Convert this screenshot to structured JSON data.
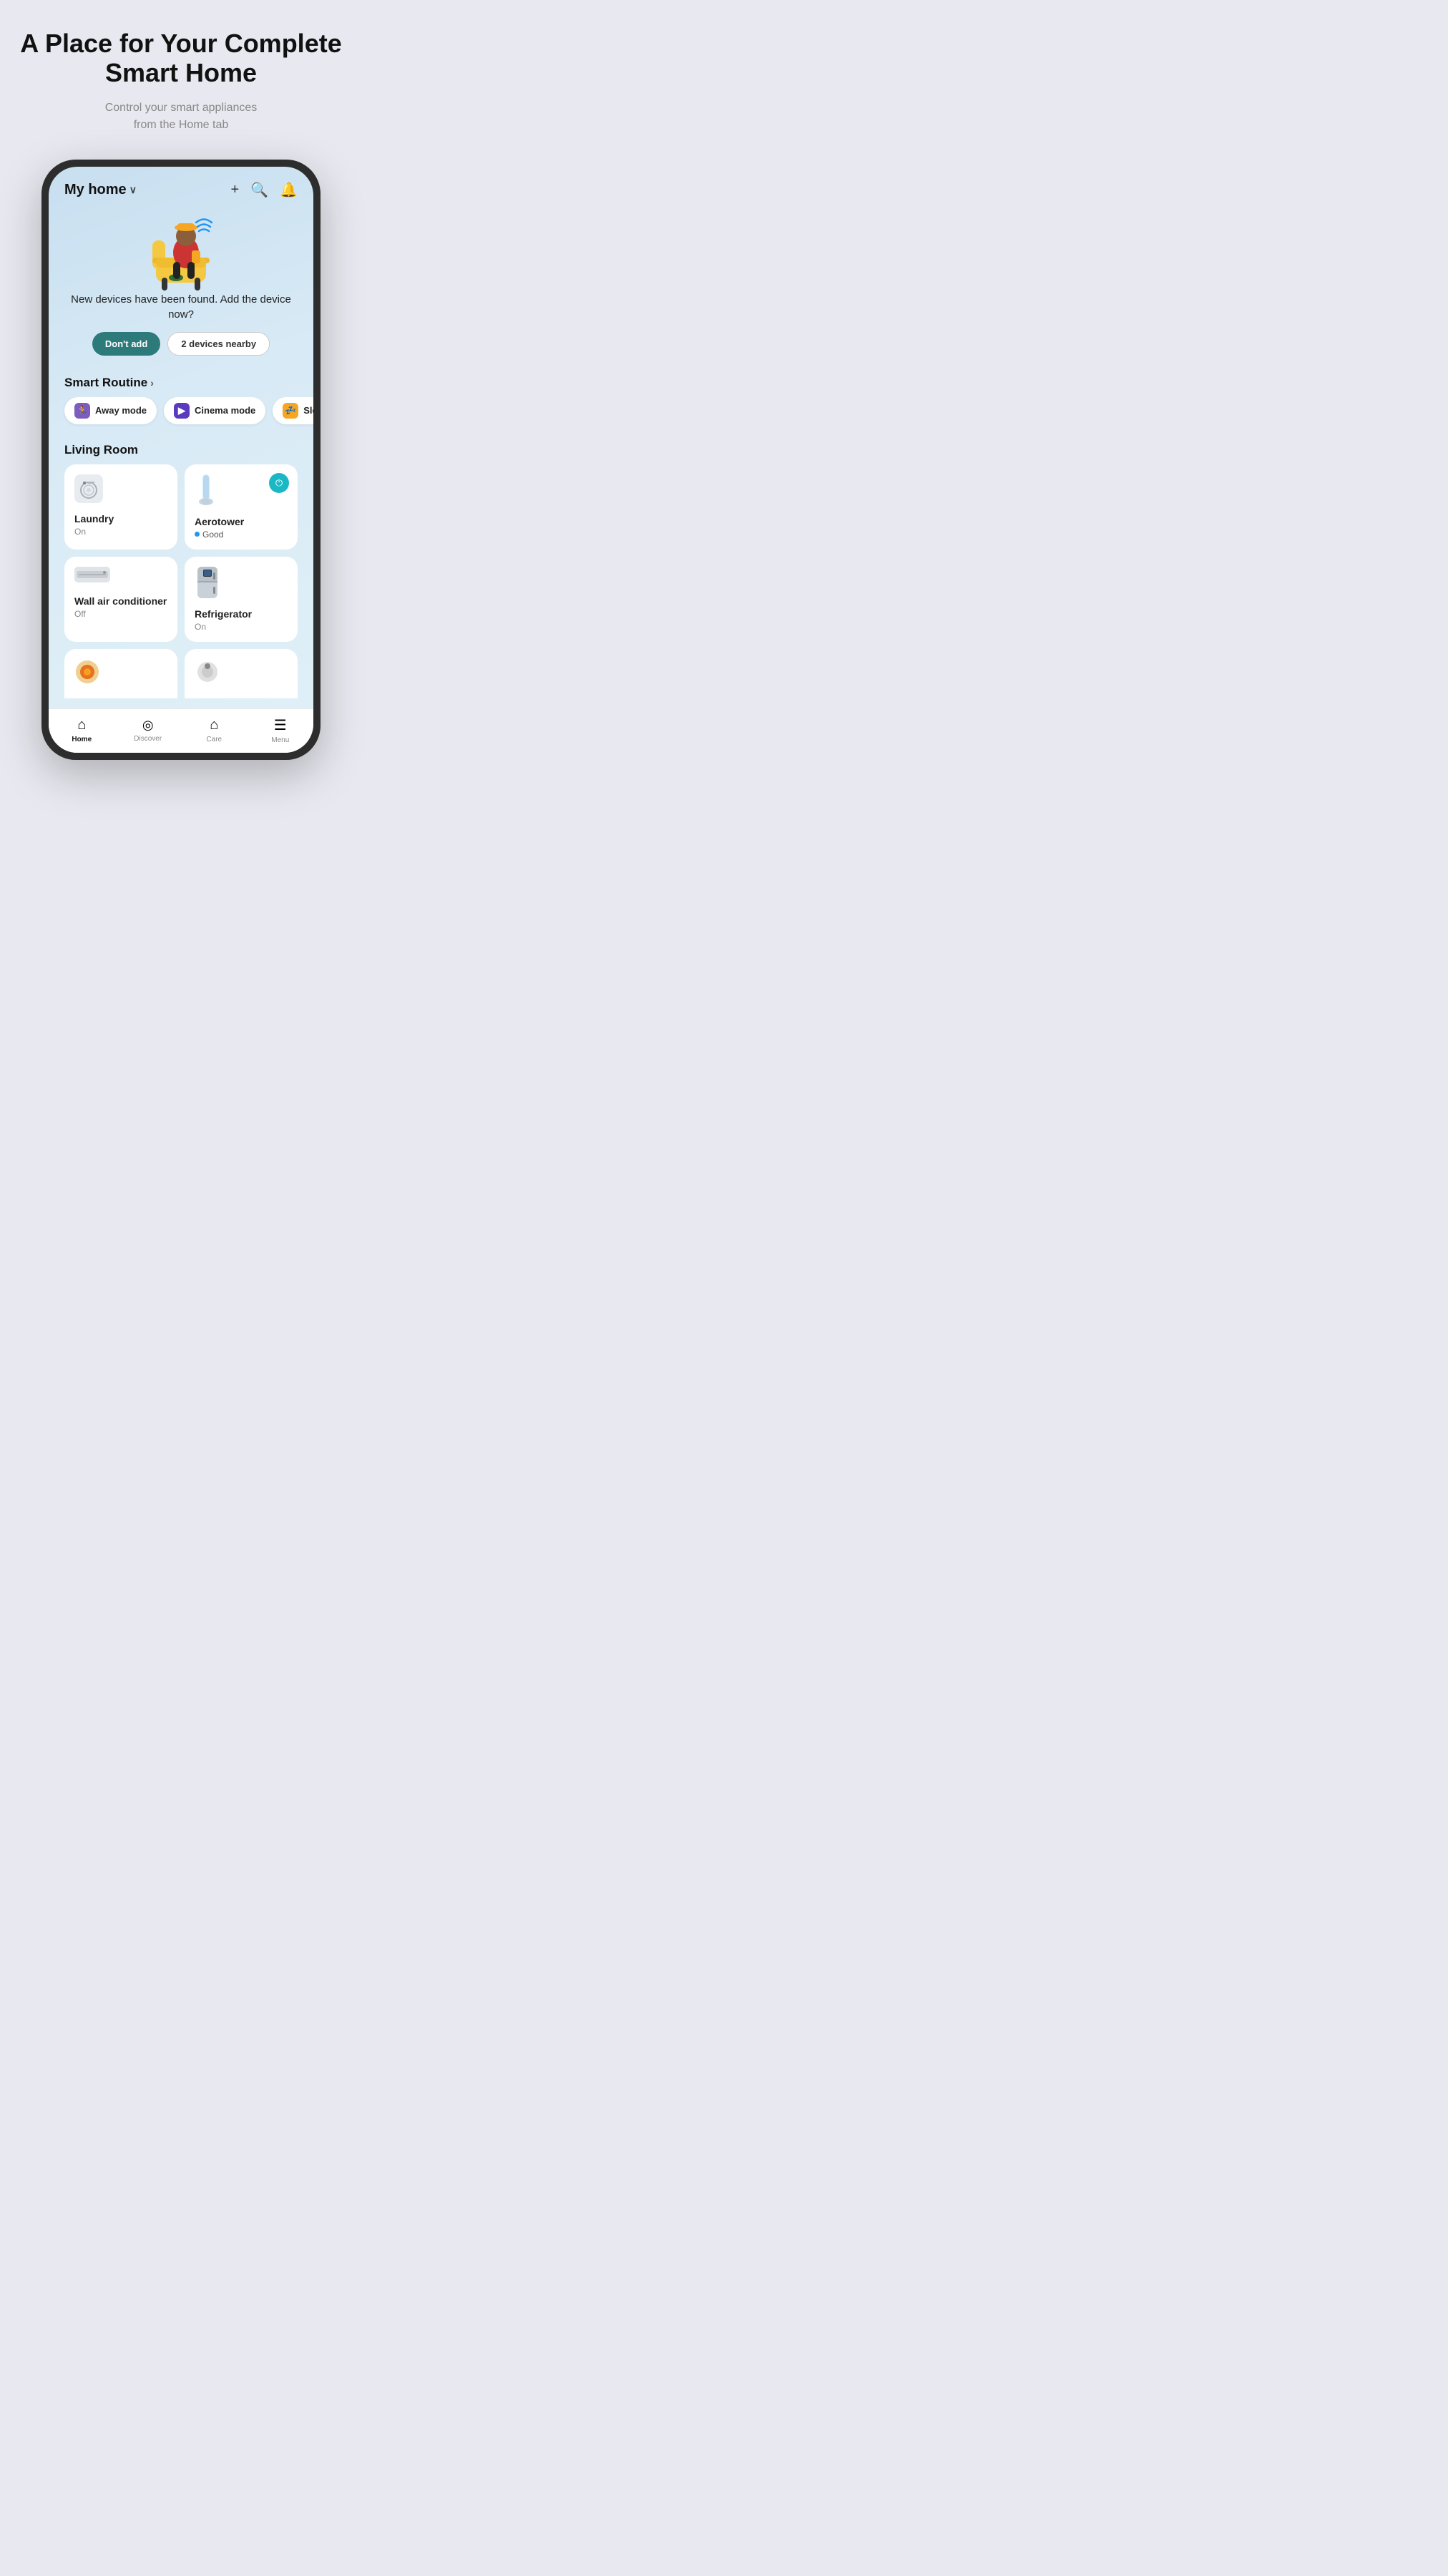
{
  "page": {
    "headline": "A Place for Your Complete Smart Home",
    "subheadline": "Control your smart appliances\nfrom the Home tab"
  },
  "phone": {
    "header": {
      "home_title": "My home",
      "chevron": "∨"
    },
    "hero": {
      "text": "New devices have been found.\nAdd the device now?",
      "btn_dont_add": "Don't add",
      "btn_devices": "2 devices nearby"
    },
    "smart_routine": {
      "label": "Smart Routine",
      "items": [
        {
          "id": "away",
          "icon": "🏃",
          "label": "Away mode",
          "icon_type": "away"
        },
        {
          "id": "cinema",
          "icon": "▶",
          "label": "Cinema mode",
          "icon_type": "cinema"
        },
        {
          "id": "sleep",
          "icon": "💤",
          "label": "Sleep",
          "icon_type": "sleep"
        }
      ]
    },
    "living_room": {
      "label": "Living Room",
      "devices": [
        {
          "id": "laundry",
          "name": "Laundry",
          "status": "On",
          "has_power_btn": false,
          "icon": "laundry"
        },
        {
          "id": "aerotower",
          "name": "Aerotower",
          "status": "Good",
          "has_power_btn": true,
          "status_type": "good",
          "icon": "aerotower"
        },
        {
          "id": "wall_ac",
          "name": "Wall air conditioner",
          "status": "Off",
          "has_power_btn": false,
          "icon": "ac"
        },
        {
          "id": "refrigerator",
          "name": "Refrigerator",
          "status": "On",
          "has_power_btn": false,
          "icon": "fridge"
        }
      ]
    },
    "bottom_nav": {
      "items": [
        {
          "id": "home",
          "icon": "⌂",
          "label": "Home",
          "active": true
        },
        {
          "id": "discover",
          "icon": "◎",
          "label": "Discover",
          "active": false
        },
        {
          "id": "care",
          "icon": "⌂",
          "label": "Care",
          "active": false
        },
        {
          "id": "menu",
          "icon": "☰",
          "label": "Menu",
          "active": false
        }
      ]
    }
  }
}
